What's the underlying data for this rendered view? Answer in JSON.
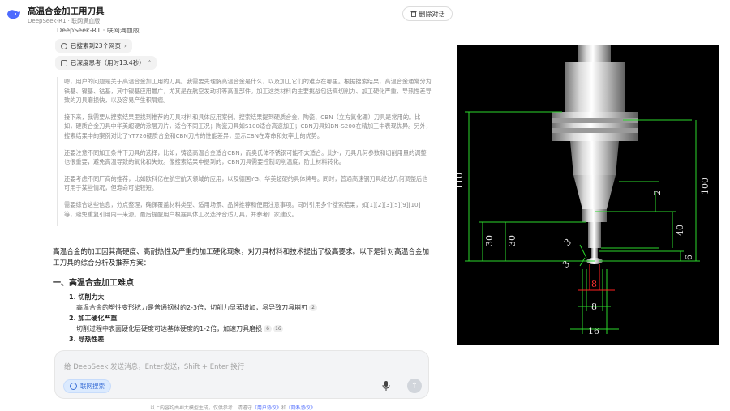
{
  "header": {
    "title": "高温合金加工用刀具",
    "subtitle": "DeepSeek-R1 · 联网满血版",
    "delete_label": "删除对话"
  },
  "chat": {
    "cut_line": "DeepSeek-R1 · 联网满血版",
    "search_chip": "已搜索到23个网页",
    "think_chip": "已深度思考（用时13.4秒）",
    "thinking": [
      "嗯，用户的问题是关于高温合金加工用的刀具。我需要先理解高温合金是什么，以及加工它们的难点在哪里。根据搜索结果，高温合金通常分为铁基、镍基、钴基，其中镍基应用最广，尤其是在航空发动机等高温部件。加工这类材料的主要挑战包括高切削力、加工硬化严重、导热性差导致的刀具磨损快，以及容易产生积屑瘤。",
      "接下来，我需要从搜索结果里找到推荐的刀具材料和具体应用案例。搜索结果提到硬质合金、陶瓷、CBN（立方氮化硼）刀具是常用的。比如，硬质合金刀具中华美超硬的涂层刀片，适合不同工况；陶瓷刀具如S100适合高速加工；CBN刀具如BN-S200在精加工中表现优异。另外，搜索结果中的案例对比了YT726硬质合金和CBN刀片的性能差异，显示CBN在寿命和效率上的优势。",
      "还要注意不同加工条件下刀具的选择，比如，铸造高温合金适合CBN，而奥氏体不锈钢可能不太适合。此外，刀具几何参数和切削用量的调整也很重要，避免高温导致的氧化和失效。像搜索结果中提到的，CBN刀具需要控制切削温度，防止材料转化。",
      "还要考虑不同厂商的推荐，比如欧科亿在航空航天领域的应用，以及德国YG、华美超硬的具体牌号。同时，普通高速钢刀具经过几何调整后也可用于某些情况，但寿命可能较短。",
      "需要综合这些信息，分点整理，确保覆盖材料类型、适用场景、品牌推荐和使用注意事项。同时引用多个搜索结果，如[1][2][3][5][9][10]等，避免重复引用同一来源。最后提醒用户根据具体工况选择合适刀具，并参考厂家建议。"
    ],
    "answer_intro": "高温合金的加工因其高硬度、高耐热性及严重的加工硬化现象，对刀具材料和技术提出了极高要求。以下是针对高温合金加工刀具的综合分析及推荐方案：",
    "section_title": "一、高温合金加工难点",
    "points": [
      {
        "title": "1. 切削力大",
        "body": "高温合金的塑性变形抗力是普通钢材的2-3倍，切削力显著增加，易导致刀具崩刃",
        "cite": "2"
      },
      {
        "title": "2. 加工硬化严重",
        "body": "切削过程中表面硬化层硬度可达基体硬度的1-2倍，加速刀具磨损",
        "cite": "6",
        "cite2": "16"
      },
      {
        "title": "3. 导热性差",
        "body": "",
        "cite": ""
      }
    ],
    "scroll_icon": "chevron-down-icon"
  },
  "input": {
    "placeholder": "给 DeepSeek 发送消息，Enter发送，Shift + Enter 换行",
    "web_search_label": "联网搜索",
    "footer_prefix": "以上内容均由AI大模型生成，仅供参考　请遵守",
    "footer_link1": "《用户协议》",
    "footer_and": "和",
    "footer_link2": "《隐私协议》"
  },
  "drawing": {
    "labels": {
      "d110": "110",
      "d100": "100",
      "d30a": "30",
      "d30b": "30",
      "d40": "40",
      "d2": "2",
      "d6": "6",
      "d3a": "3",
      "d3b": "3",
      "d8a": "8",
      "d8b": "8",
      "d16": "16"
    }
  }
}
